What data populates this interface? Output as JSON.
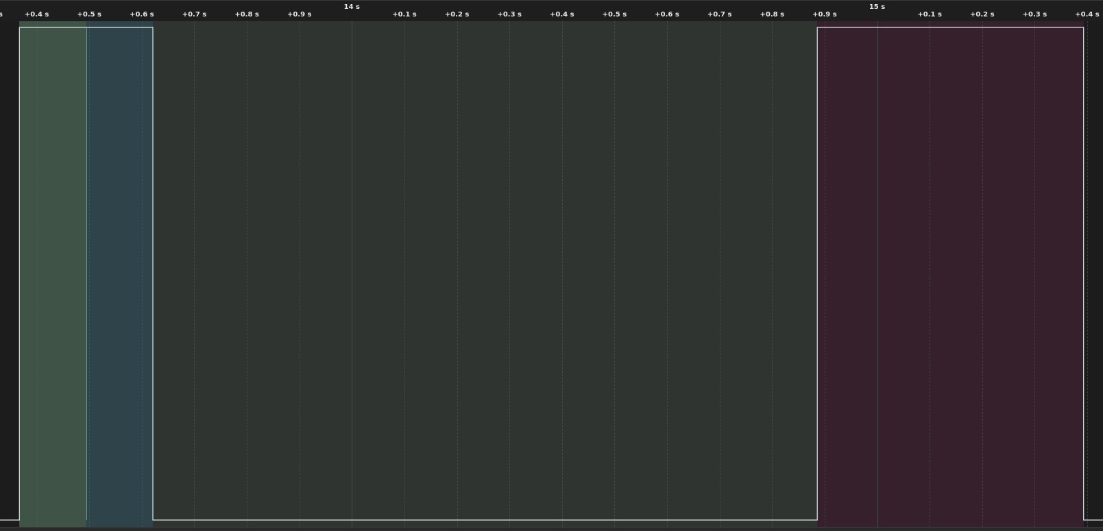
{
  "ruler": {
    "minor_ticks": [
      {
        "label": "s",
        "t": 13.32
      },
      {
        "label": "+0.4 s",
        "t": 13.4
      },
      {
        "label": "+0.5 s",
        "t": 13.5
      },
      {
        "label": "+0.6 s",
        "t": 13.6
      },
      {
        "label": "+0.7 s",
        "t": 13.7
      },
      {
        "label": "+0.8 s",
        "t": 13.8
      },
      {
        "label": "+0.9 s",
        "t": 13.9
      },
      {
        "label": "+0.1 s",
        "t": 14.1
      },
      {
        "label": "+0.2 s",
        "t": 14.2
      },
      {
        "label": "+0.3 s",
        "t": 14.3
      },
      {
        "label": "+0.4 s",
        "t": 14.4
      },
      {
        "label": "+0.5 s",
        "t": 14.5
      },
      {
        "label": "+0.6 s",
        "t": 14.6
      },
      {
        "label": "+0.7 s",
        "t": 14.7
      },
      {
        "label": "+0.8 s",
        "t": 14.8
      },
      {
        "label": "+0.9 s",
        "t": 14.9
      },
      {
        "label": "+0.1 s",
        "t": 15.1
      },
      {
        "label": "+0.2 s",
        "t": 15.2
      },
      {
        "label": "+0.3 s",
        "t": 15.3
      },
      {
        "label": "+0.4 s",
        "t": 15.4
      }
    ],
    "major_ticks": [
      {
        "label": "14 s",
        "t": 14.0
      },
      {
        "label": "15 s",
        "t": 15.0
      }
    ]
  },
  "view": {
    "t_start": 13.33,
    "t_end": 15.43
  },
  "regions": [
    {
      "name": "region-green",
      "t_start": 13.367,
      "t_end": 13.495,
      "color": "#3f5347"
    },
    {
      "name": "region-teal",
      "t_start": 13.495,
      "t_end": 13.621,
      "color": "#2e444a"
    },
    {
      "name": "region-dark-green",
      "t_start": 13.621,
      "t_end": 14.886,
      "color": "#2f3430"
    },
    {
      "name": "region-maroon",
      "t_start": 14.886,
      "t_end": 15.393,
      "color": "#35202b"
    }
  ],
  "signal": {
    "color": "#dde6e8",
    "points": [
      {
        "t": 13.33,
        "level": 0
      },
      {
        "t": 13.367,
        "level": 0
      },
      {
        "t": 13.367,
        "level": 1
      },
      {
        "t": 13.621,
        "level": 1
      },
      {
        "t": 13.621,
        "level": 0
      },
      {
        "t": 14.886,
        "level": 0
      },
      {
        "t": 14.886,
        "level": 1
      },
      {
        "t": 15.393,
        "level": 1
      },
      {
        "t": 15.393,
        "level": 0
      },
      {
        "t": 15.43,
        "level": 0
      }
    ],
    "edges": [
      {
        "t": 13.495,
        "color": "#6f9aa6"
      }
    ]
  },
  "colors": {
    "background": "#1c1c1c",
    "ruler_text": "#e6e6e6",
    "grid": "#555b57"
  }
}
